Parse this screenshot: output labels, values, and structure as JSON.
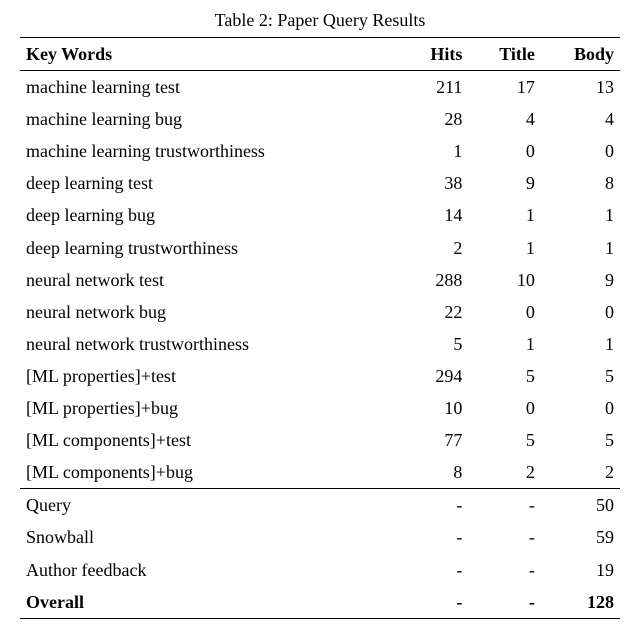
{
  "caption": "Table 2: Paper Query Results",
  "headers": {
    "c1": "Key Words",
    "c2": "Hits",
    "c3": "Title",
    "c4": "Body"
  },
  "rows_main": [
    {
      "kw": "machine learning test",
      "hits": "211",
      "title": "17",
      "body": "13"
    },
    {
      "kw": "machine learning bug",
      "hits": "28",
      "title": "4",
      "body": "4"
    },
    {
      "kw": "machine learning trustworthiness",
      "hits": "1",
      "title": "0",
      "body": "0"
    },
    {
      "kw": "deep learning test",
      "hits": "38",
      "title": "9",
      "body": "8"
    },
    {
      "kw": "deep learning bug",
      "hits": "14",
      "title": "1",
      "body": "1"
    },
    {
      "kw": "deep learning trustworthiness",
      "hits": "2",
      "title": "1",
      "body": "1"
    },
    {
      "kw": "neural network test",
      "hits": "288",
      "title": "10",
      "body": "9"
    },
    {
      "kw": "neural network bug",
      "hits": "22",
      "title": "0",
      "body": "0"
    },
    {
      "kw": "neural network trustworthiness",
      "hits": "5",
      "title": "1",
      "body": "1"
    },
    {
      "kw": "[ML properties]+test",
      "hits": "294",
      "title": "5",
      "body": "5"
    },
    {
      "kw": "[ML properties]+bug",
      "hits": "10",
      "title": "0",
      "body": "0"
    },
    {
      "kw": "[ML components]+test",
      "hits": "77",
      "title": "5",
      "body": "5"
    },
    {
      "kw": "[ML components]+bug",
      "hits": "8",
      "title": "2",
      "body": "2"
    }
  ],
  "rows_summary": [
    {
      "kw": "Query",
      "hits": "-",
      "title": "-",
      "body": "50"
    },
    {
      "kw": "Snowball",
      "hits": "-",
      "title": "-",
      "body": "59"
    },
    {
      "kw": "Author feedback",
      "hits": "-",
      "title": "-",
      "body": "19"
    }
  ],
  "overall": {
    "kw": "Overall",
    "hits": "-",
    "title": "-",
    "body": "128"
  }
}
